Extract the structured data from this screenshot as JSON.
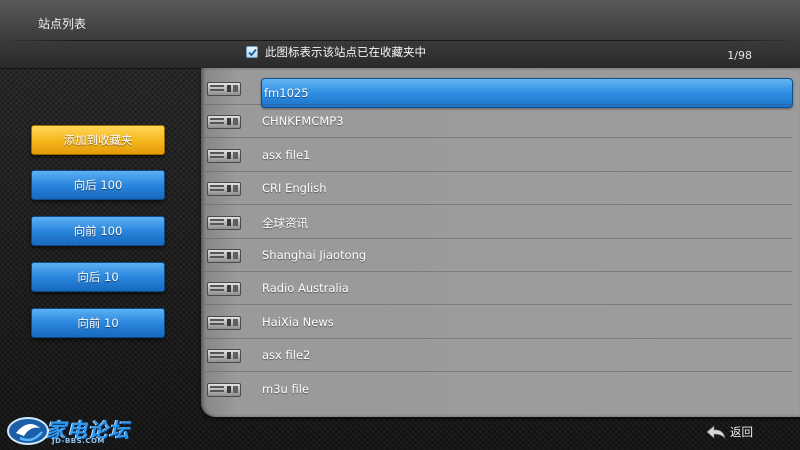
{
  "header": {
    "title": "站点列表",
    "legend_text": "此图标表示该站点已在收藏夹中",
    "page_indicator": "1/98"
  },
  "sidebar": {
    "buttons": [
      {
        "label": "添加到收藏夹",
        "style": "gold"
      },
      {
        "label": "向后 100",
        "style": "blue"
      },
      {
        "label": "向前 100",
        "style": "blue"
      },
      {
        "label": "向后 10",
        "style": "blue"
      },
      {
        "label": "向前 10",
        "style": "blue"
      }
    ]
  },
  "stations": [
    {
      "name": "fm1025",
      "selected": true
    },
    {
      "name": "CHNKFMCMP3"
    },
    {
      "name": "asx file1"
    },
    {
      "name": "CRI English"
    },
    {
      "name": "全球资讯"
    },
    {
      "name": "Shanghai Jiaotong"
    },
    {
      "name": "Radio Australia"
    },
    {
      "name": "HaiXia News"
    },
    {
      "name": "asx file2"
    },
    {
      "name": "m3u file"
    }
  ],
  "footer": {
    "logo_main": "家电论坛",
    "logo_sub": "JD-BBS.COM",
    "back_label": "返回"
  },
  "icons": {
    "station": "radio-device-icon",
    "favorite": "checkbox-favorite-icon",
    "back": "back-arrow-icon"
  },
  "colors": {
    "accent_blue": "#2a86dd",
    "accent_gold": "#f5b81e",
    "list_bg": "#9c9c9c"
  }
}
